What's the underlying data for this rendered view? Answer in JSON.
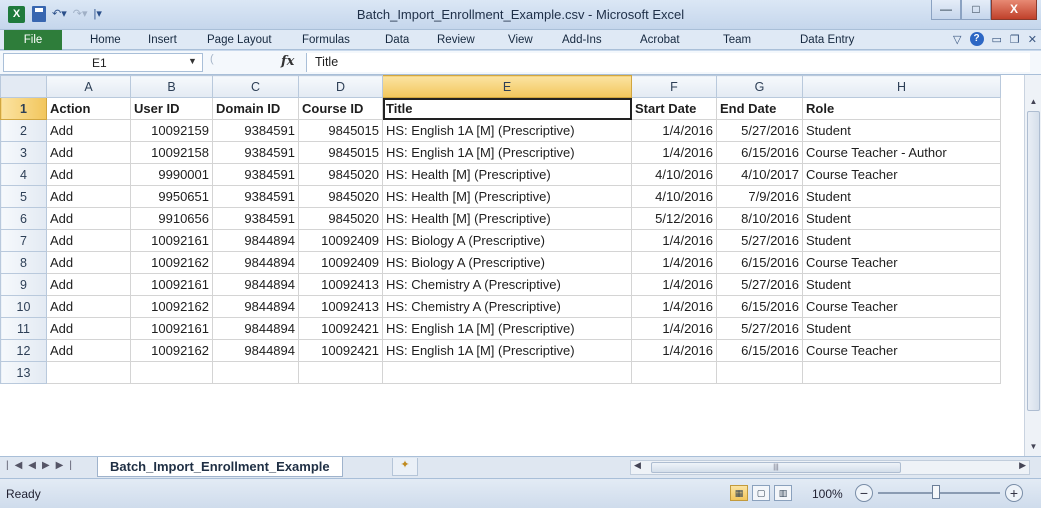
{
  "window": {
    "title": "Batch_Import_Enrollment_Example.csv - Microsoft Excel",
    "minimize": "—",
    "maximize": "□",
    "close": "X"
  },
  "ribbon": {
    "file": "File",
    "tabs": [
      "Home",
      "Insert",
      "Page Layout",
      "Formulas",
      "Data",
      "Review",
      "View",
      "Add-Ins",
      "Acrobat",
      "Team",
      "Data Entry"
    ]
  },
  "formula_bar": {
    "name_box": "E1",
    "formula": "Title"
  },
  "grid": {
    "columns": [
      "A",
      "B",
      "C",
      "D",
      "E",
      "F",
      "G",
      "H"
    ],
    "selected_column": "E",
    "rows": [
      [
        "Action",
        "User ID",
        "Domain ID",
        "Course ID",
        "Title",
        "Start Date",
        "End Date",
        "Role"
      ],
      [
        "Add",
        "10092159",
        "9384591",
        "9845015",
        "HS: English 1A [M] (Prescriptive)",
        "1/4/2016",
        "5/27/2016",
        "Student"
      ],
      [
        "Add",
        "10092158",
        "9384591",
        "9845015",
        "HS: English 1A [M] (Prescriptive)",
        "1/4/2016",
        "6/15/2016",
        "Course Teacher - Author"
      ],
      [
        "Add",
        "9990001",
        "9384591",
        "9845020",
        "HS: Health [M] (Prescriptive)",
        "4/10/2016",
        "4/10/2017",
        "Course Teacher"
      ],
      [
        "Add",
        "9950651",
        "9384591",
        "9845020",
        "HS: Health [M] (Prescriptive)",
        "4/10/2016",
        "7/9/2016",
        "Student"
      ],
      [
        "Add",
        "9910656",
        "9384591",
        "9845020",
        "HS: Health [M] (Prescriptive)",
        "5/12/2016",
        "8/10/2016",
        "Student"
      ],
      [
        "Add",
        "10092161",
        "9844894",
        "10092409",
        "HS: Biology A (Prescriptive)",
        "1/4/2016",
        "5/27/2016",
        "Student"
      ],
      [
        "Add",
        "10092162",
        "9844894",
        "10092409",
        "HS: Biology A (Prescriptive)",
        "1/4/2016",
        "6/15/2016",
        "Course Teacher"
      ],
      [
        "Add",
        "10092161",
        "9844894",
        "10092413",
        "HS: Chemistry A (Prescriptive)",
        "1/4/2016",
        "5/27/2016",
        "Student"
      ],
      [
        "Add",
        "10092162",
        "9844894",
        "10092413",
        "HS: Chemistry A (Prescriptive)",
        "1/4/2016",
        "6/15/2016",
        "Course Teacher"
      ],
      [
        "Add",
        "10092161",
        "9844894",
        "10092421",
        "HS: English 1A [M] (Prescriptive)",
        "1/4/2016",
        "5/27/2016",
        "Student"
      ],
      [
        "Add",
        "10092162",
        "9844894",
        "10092421",
        "HS: English 1A [M] (Prescriptive)",
        "1/4/2016",
        "6/15/2016",
        "Course Teacher"
      ],
      [
        "",
        "",
        "",
        "",
        "",
        "",
        "",
        ""
      ]
    ]
  },
  "sheet_tabs": {
    "active": "Batch_Import_Enrollment_Example"
  },
  "status_bar": {
    "status": "Ready",
    "zoom": "100%"
  }
}
